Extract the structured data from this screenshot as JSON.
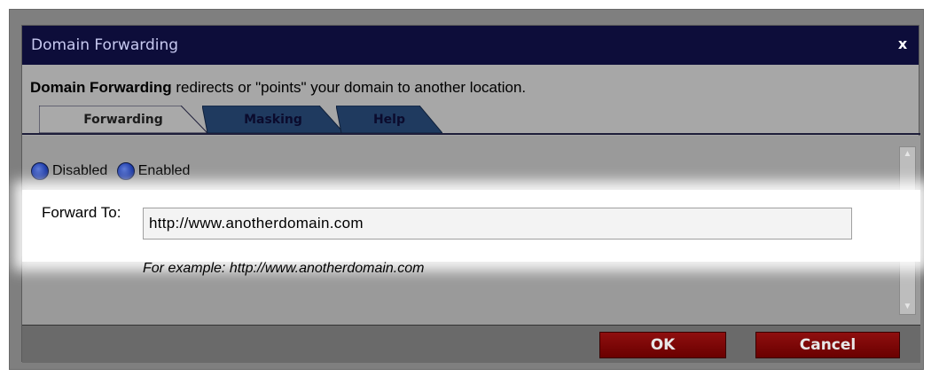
{
  "dialog": {
    "title": "Domain Forwarding",
    "close_label": "x",
    "description_bold": "Domain Forwarding",
    "description_rest": " redirects or \"points\" your domain to another location."
  },
  "tabs": [
    {
      "label": "Forwarding",
      "active": true
    },
    {
      "label": "Masking",
      "active": false
    },
    {
      "label": "Help",
      "active": false
    }
  ],
  "status": {
    "options": [
      {
        "label": "Disabled"
      },
      {
        "label": "Enabled"
      }
    ]
  },
  "forward": {
    "label": "Forward To:",
    "value": "http://www.anotherdomain.com",
    "example": "For example: http://www.anotherdomain.com"
  },
  "footer": {
    "ok_label": "OK",
    "cancel_label": "Cancel"
  },
  "colors": {
    "title_bar": "#0d0d3a",
    "button": "#7a0000",
    "tab_inactive": "#1f3a5f",
    "tab_active": "#a9a9a9"
  },
  "icons": {
    "close": "close-icon",
    "radio": "radio-button-icon",
    "scroll_up": "chevron-up-icon",
    "scroll_down": "chevron-down-icon"
  }
}
